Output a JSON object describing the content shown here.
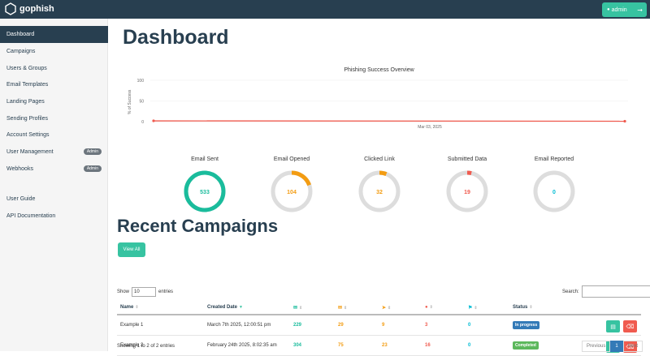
{
  "header": {
    "brand": "gophish",
    "user_label": "admin",
    "logout_icon": "logout-icon"
  },
  "sidebar": {
    "items": [
      {
        "label": "Dashboard"
      },
      {
        "label": "Campaigns"
      },
      {
        "label": "Users & Groups"
      },
      {
        "label": "Email Templates"
      },
      {
        "label": "Landing Pages"
      },
      {
        "label": "Sending Profiles"
      },
      {
        "label": "Account Settings"
      },
      {
        "label": "User Management",
        "badge": "Admin"
      },
      {
        "label": "Webhooks",
        "badge": "Admin"
      },
      {
        "label": "User Guide"
      },
      {
        "label": "API Documentation"
      }
    ]
  },
  "main": {
    "title": "Dashboard",
    "recent_title": "Recent Campaigns",
    "view_all": "View All"
  },
  "chart_data": {
    "type": "line",
    "title": "Phishing Success Overview",
    "ylabel": "% of Success",
    "yticks": [
      "100",
      "50",
      "0"
    ],
    "ylim": [
      0,
      100
    ],
    "xticks": [
      "Mar 03, 2025"
    ],
    "series": [
      {
        "color": "#f05b4f",
        "values": [
          2,
          1
        ]
      }
    ]
  },
  "stats": [
    {
      "label": "Email Sent",
      "value": "533",
      "fraction": 1.0,
      "color": "#1abc9c"
    },
    {
      "label": "Email Opened",
      "value": "104",
      "fraction": 0.195,
      "color": "#f39c12"
    },
    {
      "label": "Clicked Link",
      "value": "32",
      "fraction": 0.06,
      "color": "#f39c12"
    },
    {
      "label": "Submitted Data",
      "value": "19",
      "fraction": 0.036,
      "color": "#f05b4f"
    },
    {
      "label": "Email Reported",
      "value": "0",
      "fraction": 0,
      "color": "#00bcd4"
    }
  ],
  "table": {
    "show_label": "Show",
    "show_value": "10",
    "entries_label": "entries",
    "search_label": "Search:",
    "headers": [
      "Name",
      "Created Date",
      "Status"
    ],
    "rows": [
      {
        "name": "Example 1",
        "date": "March 7th 2025, 12:00:51 pm",
        "sent": "229",
        "opened": "29",
        "clicked": "9",
        "submitted": "3",
        "reported": "0",
        "status": "In progress",
        "status_color": "#337ab7"
      },
      {
        "name": "Example 2",
        "date": "February 24th 2025, 8:02:35 am",
        "sent": "304",
        "opened": "75",
        "clicked": "23",
        "submitted": "16",
        "reported": "0",
        "status": "Completed",
        "status_color": "#5cb85c"
      }
    ],
    "info": "Showing 1 to 2 of 2 entries",
    "pager": {
      "previous": "Previous",
      "current": "1",
      "next": "Next"
    }
  }
}
